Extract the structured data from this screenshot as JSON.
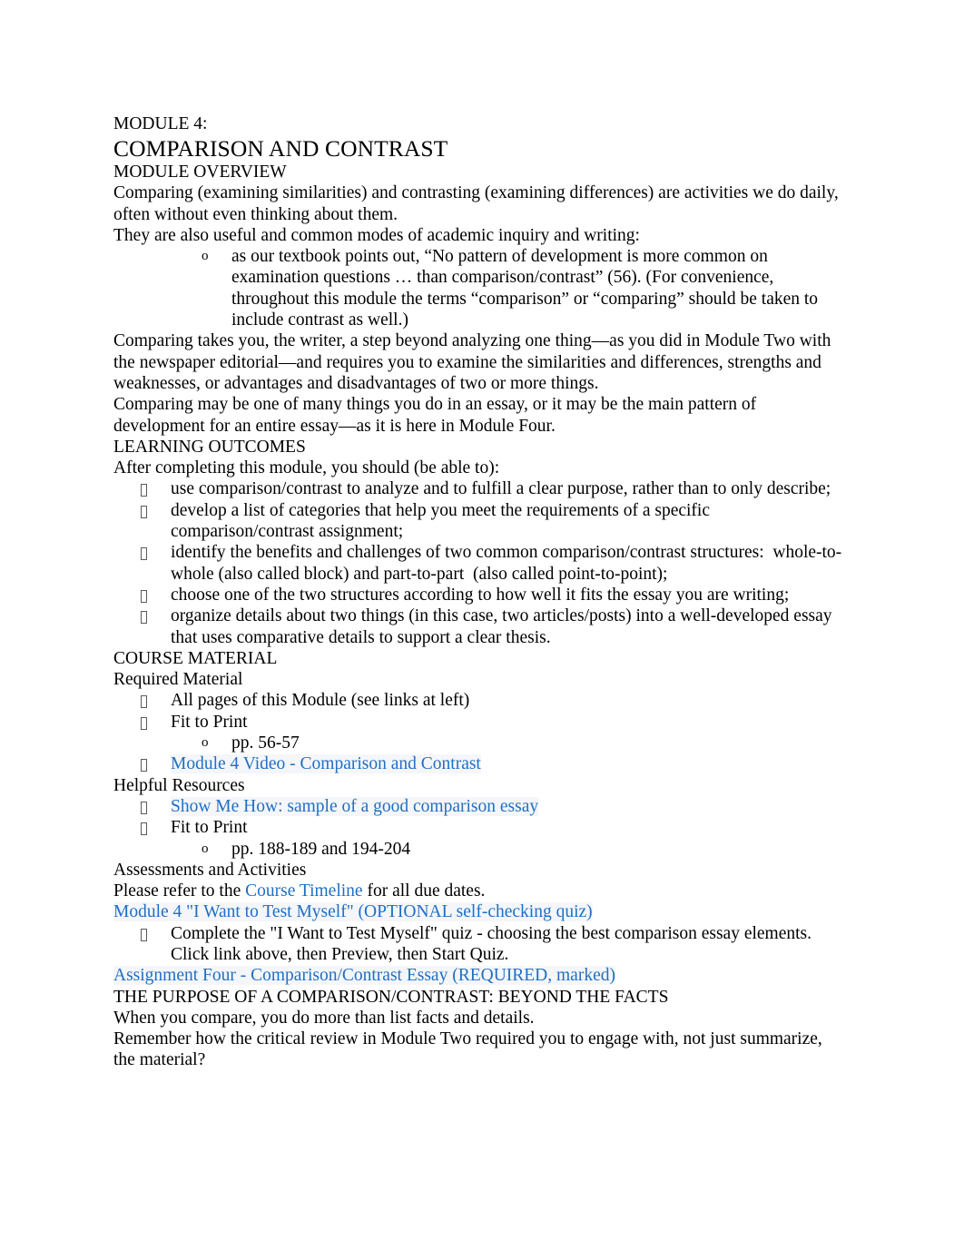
{
  "document": {
    "kicker": "MODULE 4:",
    "title": "COMPARISON AND CONTRAST",
    "link_color": "#1f6fc4",
    "sections": {
      "overview": {
        "heading": "MODULE OVERVIEW",
        "para_1": "Comparing (examining similarities) and contrasting (examining differences) are activities we do daily, often without even thinking about them.",
        "para_2": "They are also useful and common modes of academic inquiry and writing:",
        "sub_bullet_1": "as our textbook points out, “No pattern of development is more common on examination questions … than comparison/contrast” (56). (For convenience, throughout this module the terms “comparison” or “comparing” should be taken to include contrast as well.)",
        "para_3": "Comparing takes you, the writer, a step beyond analyzing one thing—as you did in Module Two with the newspaper editorial—and requires you to examine the similarities and differences, strengths and weaknesses, or advantages and disadvantages of two or more things.",
        "para_4": "Comparing may be one of many things you do in an essay, or it may be the main pattern of development for an entire essay—as it is here in Module Four."
      },
      "learning_outcomes": {
        "heading": "LEARNING OUTCOMES",
        "intro": "After completing this module, you should (be able to):",
        "items": [
          "use comparison/contrast to analyze and to fulfill a clear purpose, rather than to only describe;",
          "develop a list of categories that help you meet the requirements of a specific comparison/contrast assignment;",
          "identify the benefits and challenges of two common comparison/contrast structures:  whole-to-whole (also called block) and part-to-part  (also called point-to-point);",
          "choose one of the two structures according to how well it fits the essay you are writing;",
          "organize details about two things (in this case, two articles/posts) into a well-developed essay that uses comparative details to support a clear thesis."
        ]
      },
      "course_material": {
        "heading": "COURSE MATERIAL",
        "required_label": "Required Material",
        "required_items": [
          {
            "text": "All pages of this Module (see links at left)",
            "link": false
          },
          {
            "text": "Fit to Print",
            "link": false
          },
          {
            "text": "Module 4 Video - Comparison and Contrast",
            "link": true
          }
        ],
        "required_sub_pages": "pp. 56-57",
        "helpful_label": "Helpful Resources",
        "helpful_items": [
          {
            "text": "Show Me How: sample of a good comparison essay",
            "link": true
          },
          {
            "text": "Fit to Print",
            "link": false
          }
        ],
        "helpful_sub_pages": "pp. 188-189 and 194-204"
      },
      "assessments": {
        "heading": "Assessments and Activities",
        "due_dates_prefix": "Please refer to the ",
        "due_dates_link": "Course Timeline",
        "due_dates_suffix": " for all due dates.",
        "quiz_link": "Module 4 \"I Want to Test Myself\" (OPTIONAL self-checking quiz)",
        "quiz_bullet": "Complete the \"I Want to Test Myself\" quiz - choosing the best comparison essay elements. Click link above, then Preview, then Start Quiz.",
        "assignment_link": "Assignment Four - Comparison/Contrast Essay (REQUIRED, marked)"
      },
      "purpose": {
        "heading": "THE PURPOSE OF A COMPARISON/CONTRAST: BEYOND THE FACTS",
        "para_1": "When you compare, you do more than list facts and details.",
        "para_2": "Remember how the critical review in Module Two required you to engage with, not just summarize, the material?"
      }
    }
  }
}
